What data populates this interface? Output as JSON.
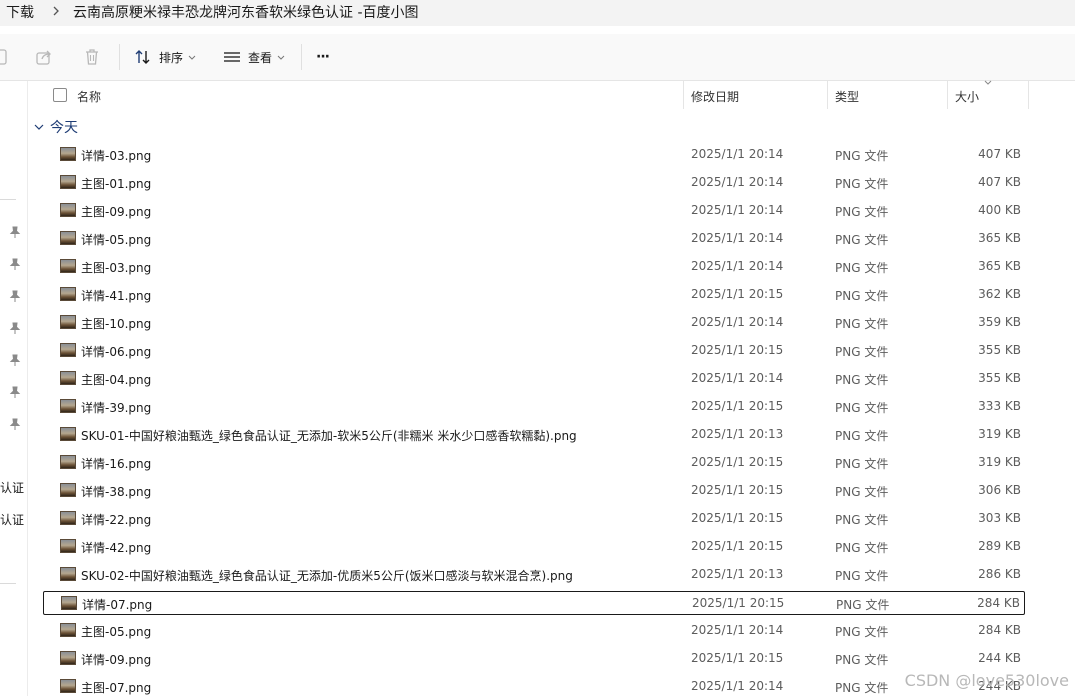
{
  "breadcrumb": {
    "parent": "下载",
    "current": "云南高原粳米禄丰恐龙牌河东香软米绿色认证 -百度小图"
  },
  "toolbar": {
    "sort_label": "排序",
    "view_label": "查看",
    "more_label": "···"
  },
  "nav": {
    "label_1": "认证",
    "label_2": "认证"
  },
  "columns": {
    "name": "名称",
    "modified": "修改日期",
    "type": "类型",
    "size": "大小"
  },
  "group": {
    "label": "今天"
  },
  "files": [
    {
      "name": "详情-03.png",
      "modified": "2025/1/1 20:14",
      "type": "PNG 文件",
      "size": "407 KB"
    },
    {
      "name": "主图-01.png",
      "modified": "2025/1/1 20:14",
      "type": "PNG 文件",
      "size": "407 KB"
    },
    {
      "name": "主图-09.png",
      "modified": "2025/1/1 20:14",
      "type": "PNG 文件",
      "size": "400 KB"
    },
    {
      "name": "详情-05.png",
      "modified": "2025/1/1 20:14",
      "type": "PNG 文件",
      "size": "365 KB"
    },
    {
      "name": "主图-03.png",
      "modified": "2025/1/1 20:14",
      "type": "PNG 文件",
      "size": "365 KB"
    },
    {
      "name": "详情-41.png",
      "modified": "2025/1/1 20:15",
      "type": "PNG 文件",
      "size": "362 KB"
    },
    {
      "name": "主图-10.png",
      "modified": "2025/1/1 20:14",
      "type": "PNG 文件",
      "size": "359 KB"
    },
    {
      "name": "详情-06.png",
      "modified": "2025/1/1 20:15",
      "type": "PNG 文件",
      "size": "355 KB"
    },
    {
      "name": "主图-04.png",
      "modified": "2025/1/1 20:14",
      "type": "PNG 文件",
      "size": "355 KB"
    },
    {
      "name": "详情-39.png",
      "modified": "2025/1/1 20:15",
      "type": "PNG 文件",
      "size": "333 KB"
    },
    {
      "name": "SKU-01-中国好粮油甄选_绿色食品认证_无添加-软米5公斤(非糯米 米水少口感香软糯黏).png",
      "modified": "2025/1/1 20:13",
      "type": "PNG 文件",
      "size": "319 KB"
    },
    {
      "name": "详情-16.png",
      "modified": "2025/1/1 20:15",
      "type": "PNG 文件",
      "size": "319 KB"
    },
    {
      "name": "详情-38.png",
      "modified": "2025/1/1 20:15",
      "type": "PNG 文件",
      "size": "306 KB"
    },
    {
      "name": "详情-22.png",
      "modified": "2025/1/1 20:15",
      "type": "PNG 文件",
      "size": "303 KB"
    },
    {
      "name": "详情-42.png",
      "modified": "2025/1/1 20:15",
      "type": "PNG 文件",
      "size": "289 KB"
    },
    {
      "name": "SKU-02-中国好粮油甄选_绿色食品认证_无添加-优质米5公斤(饭米口感淡与软米混合烹).png",
      "modified": "2025/1/1 20:13",
      "type": "PNG 文件",
      "size": "286 KB"
    },
    {
      "name": "详情-07.png",
      "modified": "2025/1/1 20:15",
      "type": "PNG 文件",
      "size": "284 KB",
      "selected": true
    },
    {
      "name": "主图-05.png",
      "modified": "2025/1/1 20:14",
      "type": "PNG 文件",
      "size": "284 KB"
    },
    {
      "name": "详情-09.png",
      "modified": "2025/1/1 20:15",
      "type": "PNG 文件",
      "size": "244 KB"
    },
    {
      "name": "主图-07.png",
      "modified": "2025/1/1 20:14",
      "type": "PNG 文件",
      "size": "244 KB"
    }
  ],
  "watermark": "CSDN @love530love"
}
